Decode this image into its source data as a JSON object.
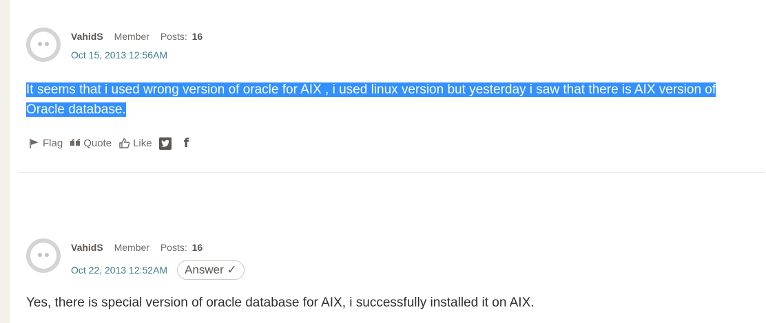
{
  "posts": [
    {
      "author": "VahidS",
      "role": "Member",
      "posts_label": "Posts:",
      "posts_count": "16",
      "date": "Oct 15, 2013 12:56AM",
      "body": "It seems that i used wrong version of oracle for AIX , i used linux version but yesterday i saw that there is AIX version of Oracle database.",
      "actions": {
        "flag": "Flag",
        "quote": "Quote",
        "like": "Like"
      }
    },
    {
      "author": "VahidS",
      "role": "Member",
      "posts_label": "Posts:",
      "posts_count": "16",
      "date": "Oct 22, 2013 12:52AM",
      "answer_badge": "Answer ✓",
      "body": "Yes, there is special version of oracle database for AIX, i successfully installed it on AIX."
    }
  ],
  "colors": {
    "selection": "#3390ff",
    "date_link": "#3f7c8a"
  },
  "icons": [
    "avatar-icon",
    "flag-icon",
    "quote-icon",
    "like-icon",
    "twitter-icon",
    "facebook-icon"
  ]
}
